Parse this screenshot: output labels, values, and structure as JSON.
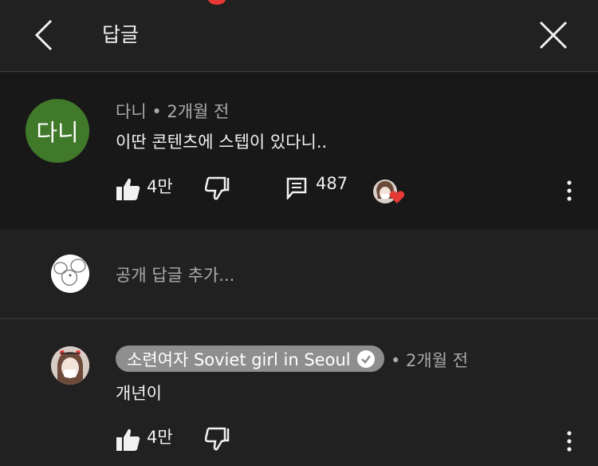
{
  "header": {
    "title": "답글",
    "back_icon": "chevron-left-icon",
    "close_icon": "close-icon"
  },
  "comment": {
    "avatar_text": "다니",
    "author": "다니",
    "separator": "•",
    "time": "2개월 전",
    "meta": "다니 • 2개월 전",
    "text": "이딴 콘텐츠에 스텝이 있다니..",
    "likes": "4만",
    "replies": "487",
    "avatar_color": "#41792b",
    "creator_heart_color": "#e53935"
  },
  "reply_input": {
    "placeholder": "공개 답글 추가..."
  },
  "reply": {
    "author": "소련여자 Soviet girl in Seoul",
    "meta": "• 2개월 전",
    "text": "개년이",
    "likes": "4만"
  },
  "colors": {
    "background": "#212121",
    "comment_background": "#181818",
    "secondary_text": "#aaaaaa",
    "author_chip": "#8e8e8e",
    "notification": "#e53935"
  }
}
